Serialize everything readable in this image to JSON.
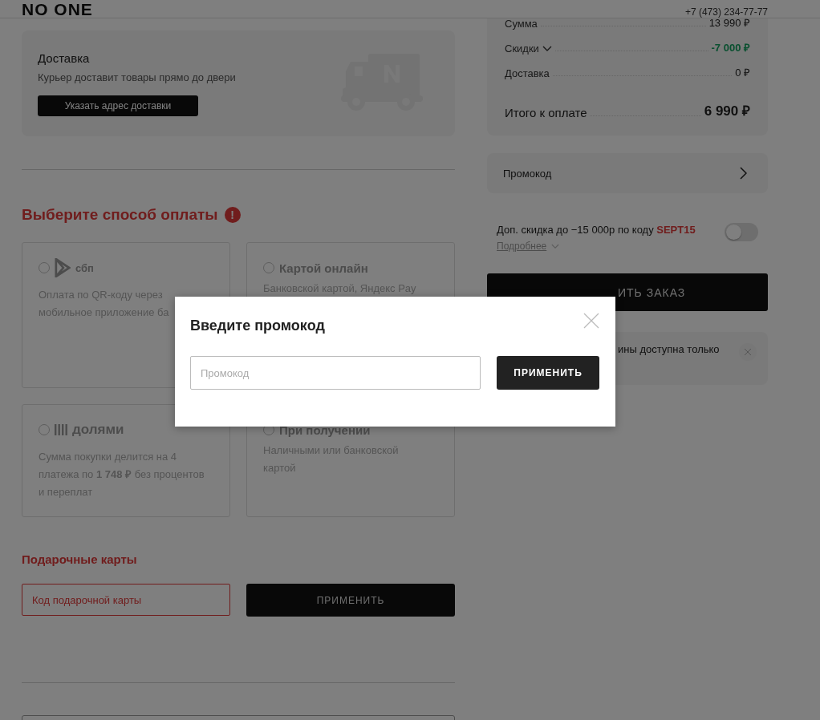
{
  "header": {
    "logo": "NO ONE",
    "phone": "+7 (473) 234-77-77"
  },
  "delivery": {
    "title": "Доставка",
    "text": "Курьер доставит товары прямо до двери",
    "button": "Указать адрес доставки"
  },
  "payment": {
    "heading": "Выберите способ оплаты",
    "error_mark": "!",
    "options": [
      {
        "kind": "sbp",
        "label": "сбп",
        "description_lines": [
          "Оплата по QR-коду через",
          "мобильное приложение ба"
        ],
        "selected": false
      },
      {
        "kind": "text",
        "label": "Картой онлайн",
        "description_lines": [
          "Банковской картой, Яндекс Pay"
        ],
        "selected": false
      },
      {
        "kind": "dolyami",
        "label": "долями",
        "description_lines": [
          "Сумма покупки делится на 4",
          "платежа по **1 748 ₽** без процентов",
          "и переплат"
        ],
        "selected": false
      },
      {
        "kind": "text",
        "label": "При получении",
        "description_lines": [
          "Наличными или банковской",
          "картой"
        ],
        "selected": false
      }
    ]
  },
  "gift_cards": {
    "heading": "Подарочные карты",
    "placeholder": "Код подарочной карты",
    "button": "ПРИМЕНИТЬ"
  },
  "summary": {
    "rows": [
      {
        "kind": "plain",
        "label": "Сумма",
        "value": "13 990 ₽",
        "expandable": false
      },
      {
        "kind": "discount",
        "label": "Скидки",
        "value": "-7 000 ₽",
        "expandable": true
      },
      {
        "kind": "plain",
        "label": "Доставка",
        "value": "0 ₽",
        "expandable": false
      }
    ],
    "total_label": "Итого к оплате",
    "total_value": "6 990 ₽"
  },
  "promo_row": {
    "label": "Промокод"
  },
  "extra_discount": {
    "text": "Доп. скидка до −15 000р по коду **SEPT15**",
    "on": false,
    "more_link": "Подробнее"
  },
  "order_button": {
    "label": "ИТЬ ЗАКАЗ"
  },
  "notice": {
    "text": "ины доступна только"
  },
  "modal": {
    "title": "Введите промокод",
    "placeholder": "Промокод",
    "button": "ПРИМЕНИТЬ"
  }
}
